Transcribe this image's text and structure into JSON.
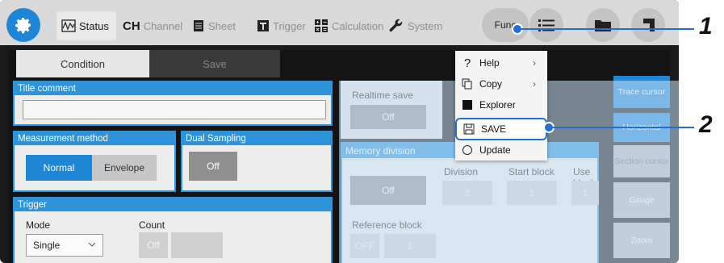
{
  "topbar": {
    "tabs": [
      {
        "label": "Status",
        "icon": "waveform-icon"
      },
      {
        "label": "Channel",
        "prefix": "CH"
      },
      {
        "label": "Sheet",
        "icon": "sheet-icon"
      },
      {
        "label": "Trigger",
        "icon": "trigger-icon"
      },
      {
        "label": "Calculation",
        "icon": "calculation-icon"
      },
      {
        "label": "System",
        "icon": "wrench-icon"
      }
    ],
    "func_label": "Func"
  },
  "subtabs": [
    "Condition",
    "Save"
  ],
  "title_comment": {
    "heading": "Title comment",
    "value": ""
  },
  "measurement": {
    "heading": "Measurement method",
    "options": [
      "Normal",
      "Envelope"
    ],
    "selected": "Normal"
  },
  "dual_sampling": {
    "heading": "Dual Sampling",
    "value": "Off"
  },
  "trigger": {
    "heading": "Trigger",
    "mode_label": "Mode",
    "mode_value": "Single",
    "count_label": "Count",
    "count_value": "Off"
  },
  "realtime_save": {
    "heading": "Realtime save",
    "value": "Off"
  },
  "memory_division": {
    "heading": "Memory division",
    "value": "Off",
    "division_label": "Division",
    "division_value": "2",
    "start_block_label": "Start block",
    "start_block_value": "1",
    "use_blocks_label": "Use blocks",
    "use_blocks_value": "1",
    "reference_block_label": "Reference block",
    "reference_state": "OFF",
    "reference_value": "1"
  },
  "side_buttons": [
    "Trace cursor",
    "Horizontal",
    "Section cursor",
    "Gauge",
    "Zoom"
  ],
  "menu": {
    "items": [
      {
        "label": "Help",
        "icon": "question-icon",
        "submenu": true
      },
      {
        "label": "Copy",
        "icon": "copy-icon",
        "submenu": true
      },
      {
        "label": "Explorer",
        "icon": "explorer-icon",
        "submenu": false
      },
      {
        "label": "SAVE",
        "icon": "save-icon",
        "submenu": false
      },
      {
        "label": "Update",
        "icon": "update-icon",
        "submenu": false
      }
    ],
    "highlighted": "SAVE"
  },
  "callouts": [
    "1",
    "2"
  ],
  "colors": {
    "accent": "#1f86d6",
    "panel_border": "#2f93da",
    "callout_line": "#1f6fd6"
  }
}
